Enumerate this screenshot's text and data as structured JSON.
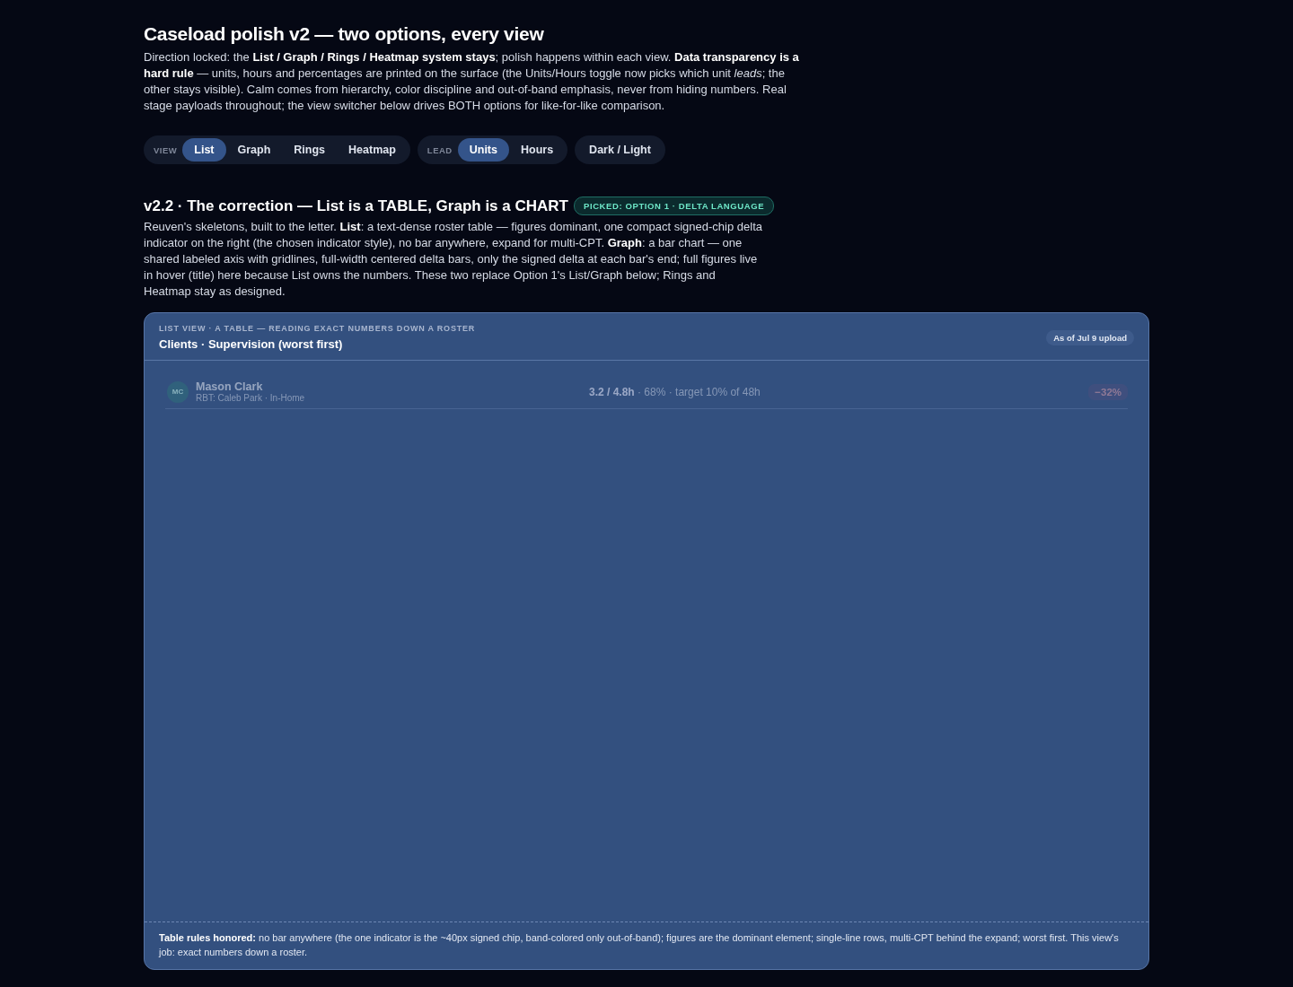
{
  "title": "Caseload polish v2 — two options, every view",
  "intro": "Direction locked: the **List / Graph / Rings / Heatmap system stays**; polish happens within each view. **Data transparency is a hard rule** — units, hours and percentages are printed on the surface (the Units/Hours toggle now picks which unit *leads*; the other stays visible). Calm comes from hierarchy, color discipline and out-of-band emphasis, never from hiding numbers. Real stage payloads throughout; the view switcher below drives BOTH options for like-for-like comparison.",
  "toolbar": [
    {
      "label": "VIEW",
      "options": [
        {
          "label": "List",
          "selected": true
        },
        {
          "label": "Graph",
          "selected": false
        },
        {
          "label": "Rings",
          "selected": false
        },
        {
          "label": "Heatmap",
          "selected": false
        }
      ]
    },
    {
      "label": "LEAD",
      "options": [
        {
          "label": "Units",
          "selected": true
        },
        {
          "label": "Hours",
          "selected": false
        }
      ]
    },
    {
      "options": [
        {
          "label": "Dark / Light",
          "selected": false
        }
      ]
    }
  ],
  "section": {
    "title": "v2.2 · The correction — List is a TABLE, Graph is a CHART",
    "badge": "PICKED: OPTION 1 · DELTA LANGUAGE",
    "description": "Reuven's skeletons, built to the letter. **List**: a text-dense roster table — figures dominant, one compact signed-chip delta indicator on the right (the chosen indicator style), no bar anywhere, expand for multi-CPT. **Graph**: a bar chart — one shared labeled axis with gridlines, full-width centered delta bars, only the signed delta at each bar's end; full figures live in hover (title) here because List owns the numbers. These two replace Option 1's List/Graph below; Rings and Heatmap stay as designed."
  },
  "card": {
    "eyebrow": "LIST VIEW · A TABLE — READING EXACT NUMBERS DOWN A ROSTER",
    "title": "Clients · Supervision (worst first)",
    "stamp": "As of Jul 9 upload",
    "rows": [
      {
        "initials": "MC",
        "name": "Mason Clark",
        "meta": "RBT: Caleb Park · In-Home",
        "figures": "**3.2 / 4.8h** · 68% · target 10% of 48h",
        "delta": "−32%"
      }
    ],
    "footer": "**Table rules honored:** no bar anywhere (the one indicator is the ~40px signed chip, band-colored only out-of-band); figures are the dominant element; single-line rows, multi-CPT behind the expand; worst first. This view's job: exact numbers down a roster."
  }
}
